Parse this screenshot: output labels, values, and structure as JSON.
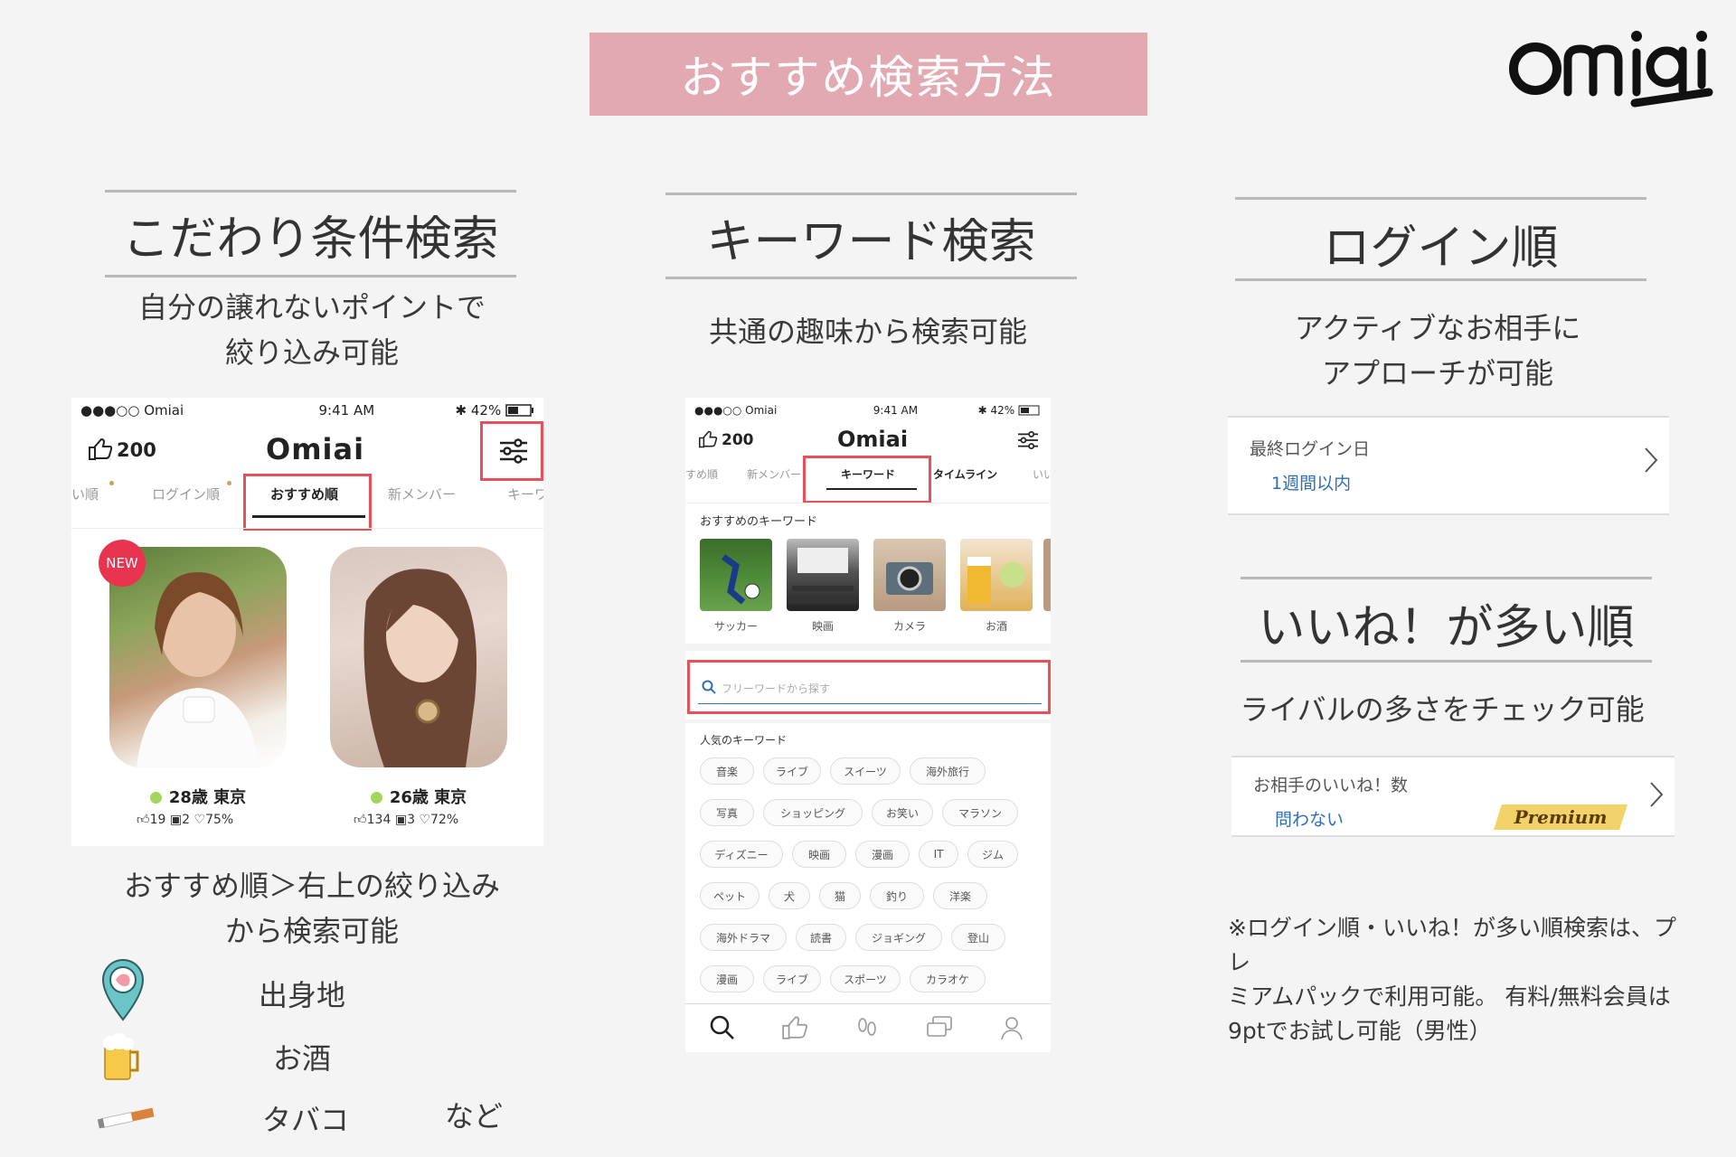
{
  "header": {
    "banner": "おすすめ検索方法",
    "logo_text": "Omiai"
  },
  "col1": {
    "title": "こだわり条件検索",
    "desc_line1": "自分の譲れないポイントで",
    "desc_line2": "絞り込み可能",
    "phone": {
      "carrier": "●●●○○ Omiai",
      "time": "9:41 AM",
      "battery": "42%",
      "likes": "200",
      "app_title": "Omiai",
      "tabs": [
        "い順",
        "ログイン順",
        "おすすめ順",
        "新メンバー",
        "キーワ"
      ],
      "new_badge": "NEW",
      "profiles": [
        {
          "age_loc": "28歳 東京",
          "likes": "19",
          "photos": "2",
          "match": "75%"
        },
        {
          "age_loc": "26歳 東京",
          "likes": "134",
          "photos": "3",
          "match": "72%"
        }
      ]
    },
    "caption_line1": "おすすめ順＞右上の絞り込み",
    "caption_line2": "から検索可能",
    "examples": [
      "出身地",
      "お酒",
      "タバコ"
    ],
    "examples_suffix": "など"
  },
  "col2": {
    "title": "キーワード検索",
    "desc": "共通の趣味から検索可能",
    "phone": {
      "carrier": "●●●○○ Omiai",
      "time": "9:41 AM",
      "battery": "42%",
      "likes": "200",
      "app_title": "Omiai",
      "tabs": [
        "すめ順",
        "新メンバー",
        "キーワード",
        "タイムライン",
        "いい"
      ],
      "recommend_heading": "おすすめのキーワード",
      "recommend": [
        "サッカー",
        "映画",
        "カメラ",
        "お酒"
      ],
      "search_placeholder": "フリーワードから探す",
      "popular_heading": "人気のキーワード",
      "chips": [
        [
          "音楽",
          "ライブ",
          "スイーツ",
          "海外旅行"
        ],
        [
          "写真",
          "ショッピング",
          "お笑い",
          "マラソン"
        ],
        [
          "ディズニー",
          "映画",
          "漫画",
          "IT",
          "ジム"
        ],
        [
          "ペット",
          "犬",
          "猫",
          "釣り",
          "洋楽"
        ],
        [
          "海外ドラマ",
          "読書",
          "ジョギング",
          "登山"
        ],
        [
          "漫画",
          "ライブ",
          "スポーツ",
          "カラオケ"
        ]
      ]
    }
  },
  "col3": {
    "title": "ログイン順",
    "desc_line1": "アクティブなお相手に",
    "desc_line2": "アプローチが可能",
    "card": {
      "label": "最終ログイン日",
      "value": "1週間以内"
    }
  },
  "col4": {
    "title": "いいね！が多い順",
    "desc": "ライバルの多さをチェック可能",
    "card": {
      "label": "お相手のいいね！数",
      "value": "問わない",
      "badge": "Premium"
    }
  },
  "note": {
    "line1": "※ログイン順・いいね！が多い順検索は、プレ",
    "line2": "ミアムパックで利用可能。 有料/無料会員は",
    "line3": "9ptでお試し可能（男性）"
  },
  "colors": {
    "banner": "#e2a9b3",
    "highlight": "#e8505b",
    "link": "#2f6fb5",
    "online": "#a4d65e",
    "premium": "#f1d36a"
  }
}
